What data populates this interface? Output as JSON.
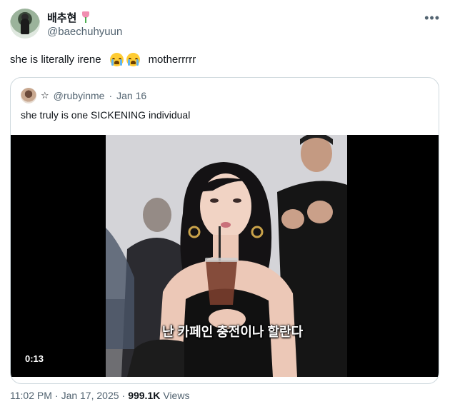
{
  "author": {
    "display_name": "배추현",
    "handle": "@baechuhyuun",
    "badge_icon": "tulip-icon"
  },
  "tweet": {
    "text_before": "she is literally irene",
    "emojis": [
      "loudly-crying-face-icon",
      "loudly-crying-face-icon"
    ],
    "text_after": "motherrrrr"
  },
  "quoted": {
    "handle": "@rubyinme",
    "separator": "·",
    "date": "Jan 16",
    "text": "she truly is one SICKENING individual",
    "video": {
      "subtitle": "난 카페인 충전이나 할란다",
      "duration": "0:13"
    }
  },
  "meta": {
    "time": "11:02 PM",
    "separator1": "·",
    "date": "Jan 17, 2025",
    "separator2": "·",
    "views_count": "999.1K",
    "views_label": "Views"
  },
  "colors": {
    "text_primary": "#0f1419",
    "text_secondary": "#536471",
    "border": "#cfd9de",
    "video_bg": "#000000"
  }
}
